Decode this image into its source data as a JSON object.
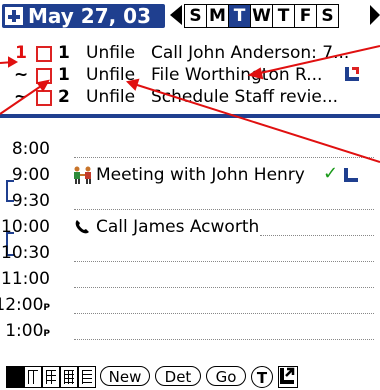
{
  "header": {
    "date": "May 27, 03",
    "days": [
      "S",
      "M",
      "T",
      "W",
      "T",
      "F",
      "S"
    ],
    "selected_day_index": 2
  },
  "todos": [
    {
      "mark": "1",
      "priority": "1",
      "category": "Unfile",
      "description": "Call John Anderson: 7...",
      "has_note": false
    },
    {
      "mark": "~",
      "priority": "1",
      "category": "Unfile",
      "description": "File Worthington R...",
      "has_note": true
    },
    {
      "mark": "~",
      "priority": "2",
      "category": "Unfile",
      "description": "Schedule Staff revie...",
      "has_note": false
    }
  ],
  "day_view": {
    "slots": [
      {
        "time": "8:00",
        "suffix": "",
        "event": ""
      },
      {
        "time": "9:00",
        "suffix": "",
        "event": "Meeting with John Henry"
      },
      {
        "time": "9:30",
        "suffix": "",
        "event": ""
      },
      {
        "time": "10:00",
        "suffix": "",
        "event": "Call James Acworth"
      },
      {
        "time": "10:30",
        "suffix": "",
        "event": ""
      },
      {
        "time": "11:00",
        "suffix": "",
        "event": ""
      },
      {
        "time": "12:00",
        "suffix": "P",
        "event": ""
      },
      {
        "time": "1:00",
        "suffix": "P",
        "event": ""
      }
    ]
  },
  "toolbar": {
    "new_label": "New",
    "details_label": "Det",
    "go_label": "Go",
    "todo_label": "T"
  },
  "colors": {
    "accent": "#1f3f8f",
    "checkbox": "#d22222",
    "complete": "#1a9a1a",
    "annotation": "#e01010"
  },
  "icons": [
    "new-event-icon",
    "arrow-left-icon",
    "arrow-right-icon",
    "note-icon",
    "people-icon",
    "phone-icon",
    "check-icon",
    "expand-icon"
  ]
}
